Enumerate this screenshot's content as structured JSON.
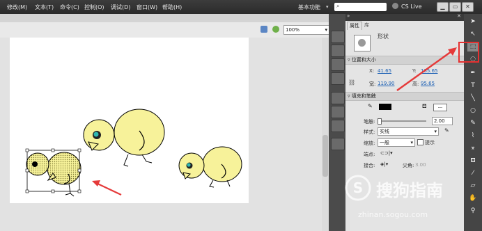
{
  "menu": {
    "items": [
      "修改(M)",
      "文本(T)",
      "命令(C)",
      "控制(O)",
      "调试(D)",
      "窗口(W)",
      "帮助(H)"
    ],
    "workspace": "基本功能",
    "search_placeholder": "",
    "cs_live": "CS Live",
    "win_min": "▁",
    "win_max": "▭",
    "win_close": "✕"
  },
  "editbar": {
    "zoom": "100%"
  },
  "properties": {
    "tab_properties": "属性",
    "tab_library": "库",
    "instance_type": "形状",
    "section_position": "位置和大小",
    "x_label": "X:",
    "x_value": "41.65",
    "y_label": "Y:",
    "y_value": "185.65",
    "w_label": "宽:",
    "w_value": "119.90",
    "h_label": "高:",
    "h_value": "95.65",
    "section_fill": "填充和笔触",
    "stroke_label": "笔触:",
    "stroke_value": "2.00",
    "style_label": "样式:",
    "style_value": "实线",
    "scale_label": "缩放:",
    "scale_value": "一般",
    "hint_label": "提示",
    "cap_label": "端点:",
    "join_label": "接合:",
    "miter_label": "尖角:",
    "miter_value": "3.00"
  },
  "watermark": {
    "logo_text": "S",
    "title": "搜狗指南",
    "url": "zhinan.sogou.com"
  },
  "colors": {
    "chick_fill": "#f7f29a",
    "arrow": "#e53a3a",
    "highlight": "#e53030",
    "stroke_swatch": "#000000"
  },
  "icons": [
    "selection-tool-icon",
    "subselect-tool-icon",
    "free-transform-tool-icon",
    "lasso-tool-icon",
    "pen-tool-icon",
    "text-tool-icon",
    "line-tool-icon",
    "rect-tool-icon",
    "pencil-tool-icon",
    "brush-tool-icon",
    "bone-tool-icon",
    "paint-bucket-icon",
    "eyedropper-icon",
    "eraser-icon",
    "hand-icon",
    "zoom-icon"
  ]
}
